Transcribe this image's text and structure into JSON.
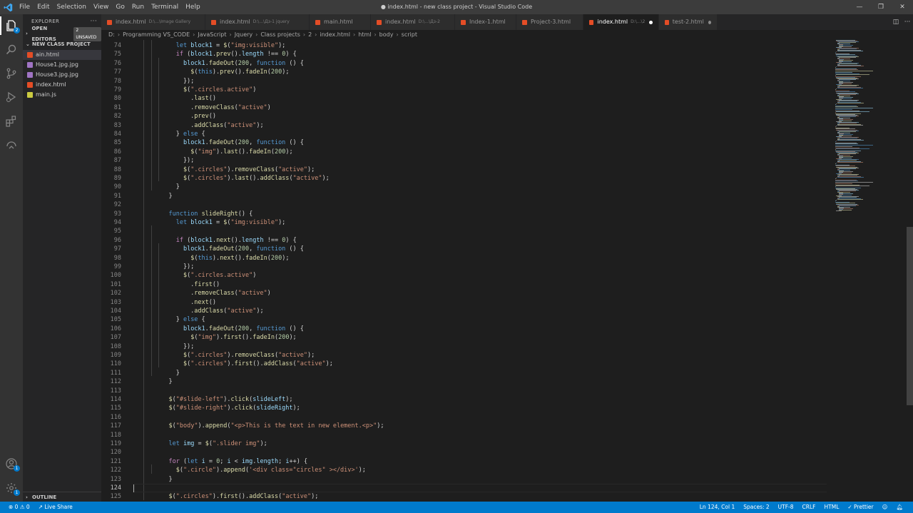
{
  "window": {
    "title": "● index.html - new class project - Visual Studio Code",
    "menu": [
      "File",
      "Edit",
      "Selection",
      "View",
      "Go",
      "Run",
      "Terminal",
      "Help"
    ],
    "controls": [
      "—",
      "❐",
      "✕"
    ]
  },
  "activity": {
    "explorer_badge": "2",
    "accounts_badge": "1",
    "settings_badge": "1"
  },
  "sidebar": {
    "title": "EXPLORER",
    "more": "···",
    "open_editors": "OPEN EDITORS",
    "unsaved_badge": "2 UNSAVED",
    "project": "NEW CLASS PROJECT",
    "files": [
      {
        "name": "ain.html",
        "color": "#e44d26"
      },
      {
        "name": "House1.jpg.jpg",
        "color": "#a074c4"
      },
      {
        "name": "House3.jpg.jpg",
        "color": "#a074c4"
      },
      {
        "name": "index.html",
        "color": "#e44d26"
      },
      {
        "name": "main.js",
        "color": "#cbcb41"
      }
    ],
    "outline": "OUTLINE"
  },
  "tabs": [
    {
      "label": "index.html",
      "hint": "D:\\...\\Image Gallery"
    },
    {
      "label": "index.html",
      "hint": "D:\\...\\Дз-1 jquery"
    },
    {
      "label": "main.html",
      "hint": ""
    },
    {
      "label": "index.html",
      "hint": "D:\\...\\Дз-2"
    },
    {
      "label": "Index-1.html",
      "hint": ""
    },
    {
      "label": "Project-3.html",
      "hint": ""
    },
    {
      "label": "index.html",
      "hint": "D:\\...\\2"
    },
    {
      "label": "test-2.html",
      "hint": ""
    }
  ],
  "breadcrumb": [
    "D:",
    "Programming VS_CODE",
    "JavaScript",
    "Jquery",
    "Class projects",
    "2",
    "index.html",
    "html",
    "body",
    "script"
  ],
  "editor": {
    "lines": [
      {
        "n": "74",
        "t": "      let block1 = $(\"img:visible\");"
      },
      {
        "n": "75",
        "t": "      if (block1.prev().length !== 0) {"
      },
      {
        "n": "76",
        "t": "        block1.fadeOut(200, function () {"
      },
      {
        "n": "77",
        "t": "          $(this).prev().fadeIn(200);"
      },
      {
        "n": "78",
        "t": "        });"
      },
      {
        "n": "79",
        "t": "        $(\".circles.active\")"
      },
      {
        "n": "80",
        "t": "          .last()"
      },
      {
        "n": "81",
        "t": "          .removeClass(\"active\")"
      },
      {
        "n": "82",
        "t": "          .prev()"
      },
      {
        "n": "83",
        "t": "          .addClass(\"active\");"
      },
      {
        "n": "84",
        "t": "      } else {"
      },
      {
        "n": "85",
        "t": "        block1.fadeOut(200, function () {"
      },
      {
        "n": "86",
        "t": "          $(\"img\").last().fadeIn(200);"
      },
      {
        "n": "87",
        "t": "        });"
      },
      {
        "n": "88",
        "t": "        $(\".circles\").removeClass(\"active\");"
      },
      {
        "n": "89",
        "t": "        $(\".circles\").last().addClass(\"active\");"
      },
      {
        "n": "90",
        "t": "      }"
      },
      {
        "n": "91",
        "t": "    }"
      },
      {
        "n": "92",
        "t": ""
      },
      {
        "n": "93",
        "t": "    function slideRight() {"
      },
      {
        "n": "94",
        "t": "      let block1 = $(\"img:visible\");"
      },
      {
        "n": "95",
        "t": ""
      },
      {
        "n": "96",
        "t": "      if (block1.next().length !== 0) {"
      },
      {
        "n": "97",
        "t": "        block1.fadeOut(200, function () {"
      },
      {
        "n": "98",
        "t": "          $(this).next().fadeIn(200);"
      },
      {
        "n": "99",
        "t": "        });"
      },
      {
        "n": "100",
        "t": "        $(\".circles.active\")"
      },
      {
        "n": "101",
        "t": "          .first()"
      },
      {
        "n": "102",
        "t": "          .removeClass(\"active\")"
      },
      {
        "n": "103",
        "t": "          .next()"
      },
      {
        "n": "104",
        "t": "          .addClass(\"active\");"
      },
      {
        "n": "105",
        "t": "      } else {"
      },
      {
        "n": "106",
        "t": "        block1.fadeOut(200, function () {"
      },
      {
        "n": "107",
        "t": "          $(\"img\").first().fadeIn(200);"
      },
      {
        "n": "108",
        "t": "        });"
      },
      {
        "n": "109",
        "t": "        $(\".circles\").removeClass(\"active\");"
      },
      {
        "n": "110",
        "t": "        $(\".circles\").first().addClass(\"active\");"
      },
      {
        "n": "111",
        "t": "      }"
      },
      {
        "n": "112",
        "t": "    }"
      },
      {
        "n": "113",
        "t": ""
      },
      {
        "n": "114",
        "t": "    $(\"#slide-left\").click(slideLeft);"
      },
      {
        "n": "115",
        "t": "    $(\"#slide-right\").click(slideRight);"
      },
      {
        "n": "116",
        "t": ""
      },
      {
        "n": "117",
        "t": "    $(\"body\").append(\"<p>This is the text in new element.<p>\");"
      },
      {
        "n": "118",
        "t": ""
      },
      {
        "n": "119",
        "t": "    let img = $(\".slider img\");"
      },
      {
        "n": "120",
        "t": ""
      },
      {
        "n": "121",
        "t": "    for (let i = 0; i < img.length; i++) {"
      },
      {
        "n": "122",
        "t": "      $(\".circle\").append('<div class=\"circles\" ></div>');"
      },
      {
        "n": "123",
        "t": "    }"
      },
      {
        "n": "124",
        "t": ""
      },
      {
        "n": "125",
        "t": "    $(\".circles\").first().addClass(\"active\");"
      }
    ]
  },
  "statusbar": {
    "problems": "⊗ 0  ⚠ 0",
    "live_share": "Live Share",
    "position": "Ln 124, Col 1",
    "spaces": "Spaces: 2",
    "encoding": "UTF-8",
    "eol": "CRLF",
    "language": "HTML",
    "prettier": "✓ Prettier"
  },
  "colors": {
    "accent": "#007acc",
    "keyword": "#569cd6",
    "string": "#ce9178",
    "function": "#dcdcaa",
    "variable": "#9cdcfe",
    "number": "#b5cea8",
    "control": "#c586c0"
  }
}
